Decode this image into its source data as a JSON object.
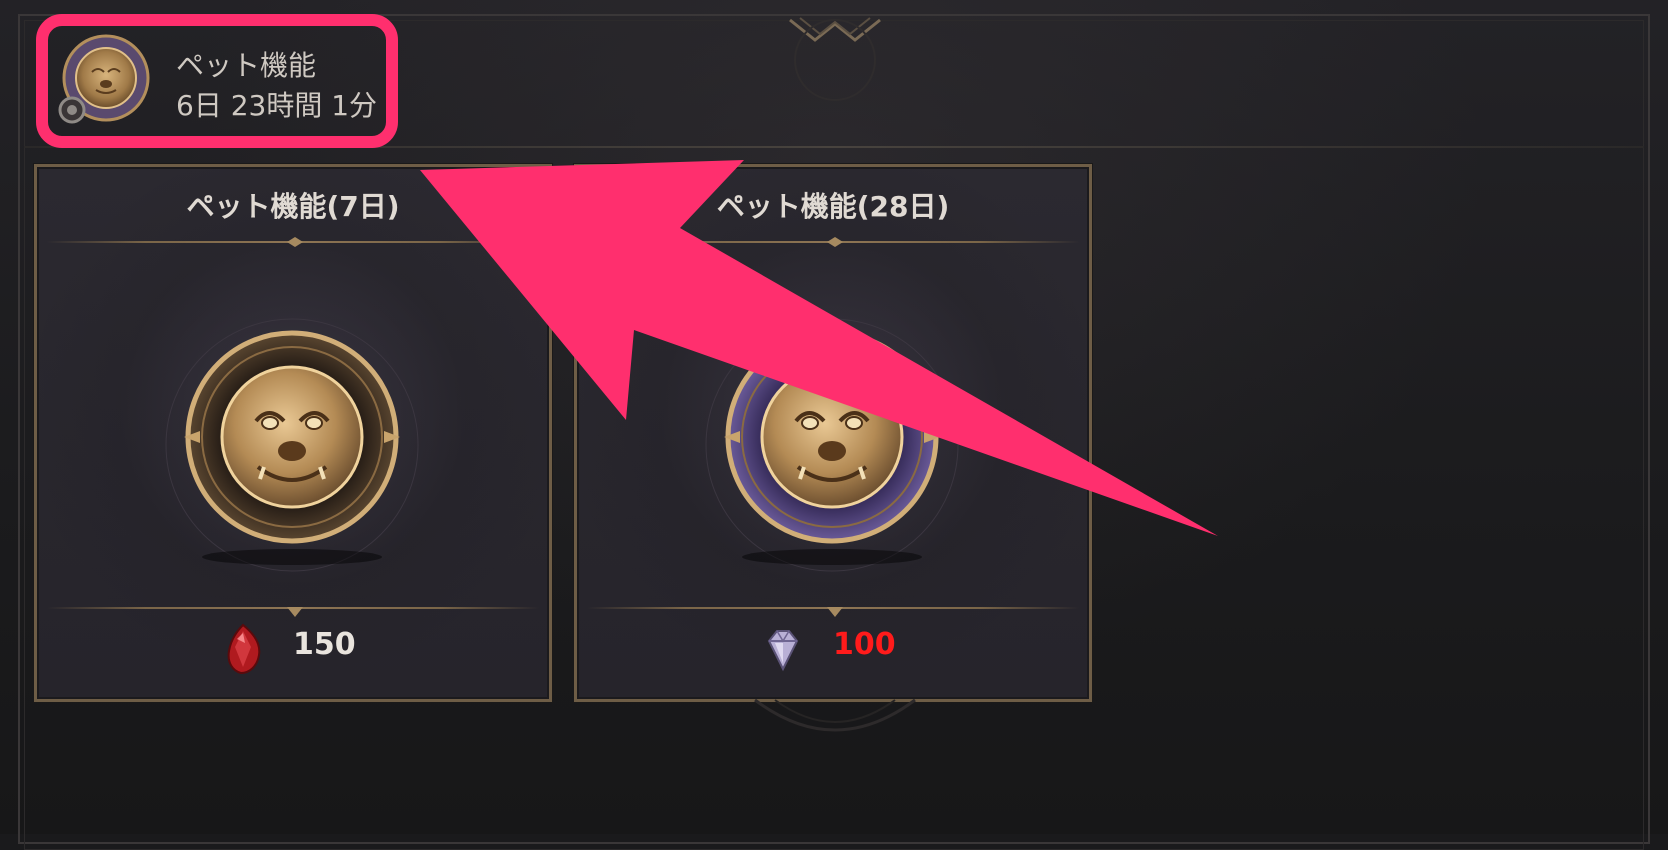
{
  "status": {
    "name": "ペット機能",
    "remaining": "6日 23時間 1分",
    "icon": "pet-medal-icon"
  },
  "cards": [
    {
      "title": "ペット機能(7日)",
      "price": "150",
      "currency_icon": "red-gem-icon",
      "price_color": "#e9e4de",
      "medal_ring_color": "#5a4630"
    },
    {
      "title": "ペット機能(28日)",
      "price": "100",
      "currency_icon": "purple-diamond-icon",
      "price_color": "#ff1b1b",
      "medal_ring_color": "#4b3f72"
    }
  ],
  "colors": {
    "highlight": "#ff2f6e",
    "background": "#1a1a1c",
    "card_border": "#6e5d46",
    "gold": "#c8a56c"
  }
}
